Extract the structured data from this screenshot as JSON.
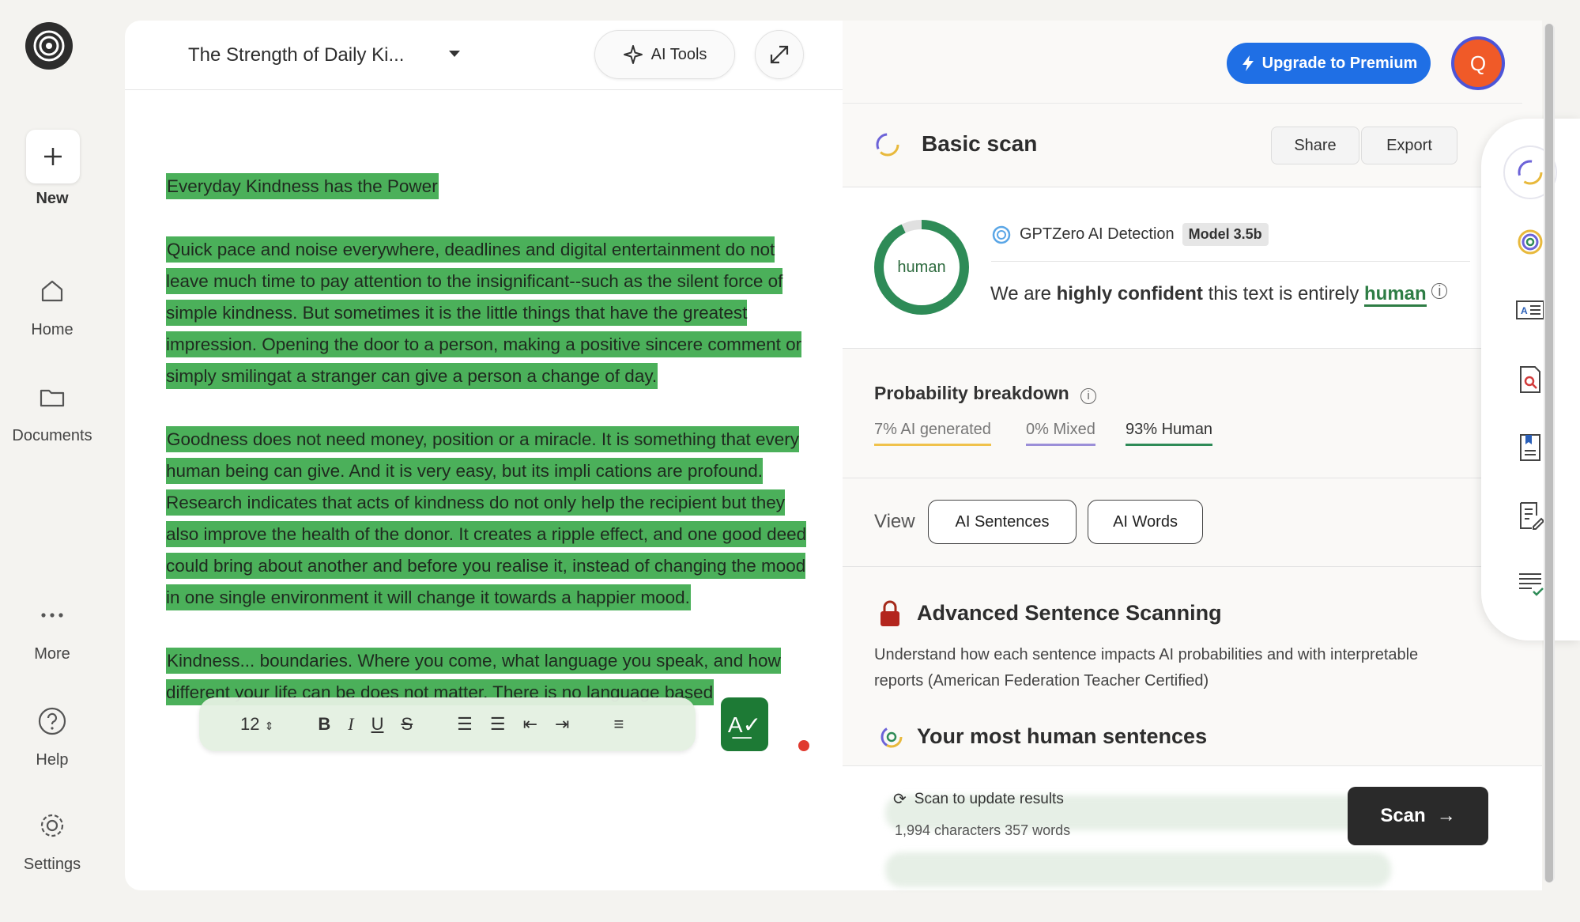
{
  "nav": {
    "new_label": "New",
    "items": [
      {
        "label": "Home",
        "icon": "home-icon"
      },
      {
        "label": "Documents",
        "icon": "folder-icon"
      },
      {
        "label": "More",
        "icon": "more-icon"
      },
      {
        "label": "Help",
        "icon": "help-icon"
      },
      {
        "label": "Settings",
        "icon": "gear-icon"
      }
    ]
  },
  "editor": {
    "doc_title": "The Strength of Daily Ki...",
    "ai_tools_label": "AI Tools",
    "heading": "Everyday Kindness has the Power",
    "paragraph1": "Quick pace and noise everywhere, deadlines and digital entertainment do not leave much time to pay attention to the insignificant--such as the silent force of simple kindness. But sometimes it is the little things that have the greatest impression. Opening the door to a person, making a positive sincere comment or simply smilingat a stranger can give a person a change of day.",
    "paragraph2": "Goodness does not need money, position or a miracle. It is something that every human being can give. And it is very easy, but its impli cations are profound. Research indicates that acts of kindness do not only help the recipient but they also improve the health of the donor. It creates a ripple effect, and one good deed could bring about another and before you realise it, instead of changing the mood in one single environment it will change it towards a happier mood.",
    "paragraph3": "Kindness... boundaries. Where you come, what language you speak, and how different your life can be does not matter. There is no language based",
    "font_size": "12"
  },
  "header": {
    "upgrade_label": "Upgrade to Premium",
    "avatar_initial": "Q"
  },
  "scan": {
    "title": "Basic scan",
    "share_label": "Share",
    "export_label": "Export",
    "donut_label": "human",
    "human_fraction": 0.93,
    "detector": "GPTZero AI Detection",
    "model": "Model 3.5b",
    "confidence_prefix": "We are",
    "confidence_strong": "highly confident",
    "confidence_mid": "this text is entirely",
    "confidence_result": "human"
  },
  "probability": {
    "title": "Probability breakdown",
    "ai": "7% AI generated",
    "mixed": "0% Mixed",
    "human": "93% Human",
    "colors": {
      "ai": "#f0c24b",
      "mixed": "#9b8fd8",
      "human": "#2e8b57"
    }
  },
  "view": {
    "label": "View",
    "ai_sentences": "AI Sentences",
    "ai_words": "AI Words"
  },
  "advanced": {
    "title": "Advanced Sentence Scanning",
    "description": "Understand how each sentence impacts AI probabilities and with interpretable reports (American Federation Teacher Certified)",
    "human_sentences_title": "Your most human sentences"
  },
  "footer": {
    "scan_update": "Scan to update results",
    "counts": "1,994 characters 357 words",
    "scan_label": "Scan"
  }
}
